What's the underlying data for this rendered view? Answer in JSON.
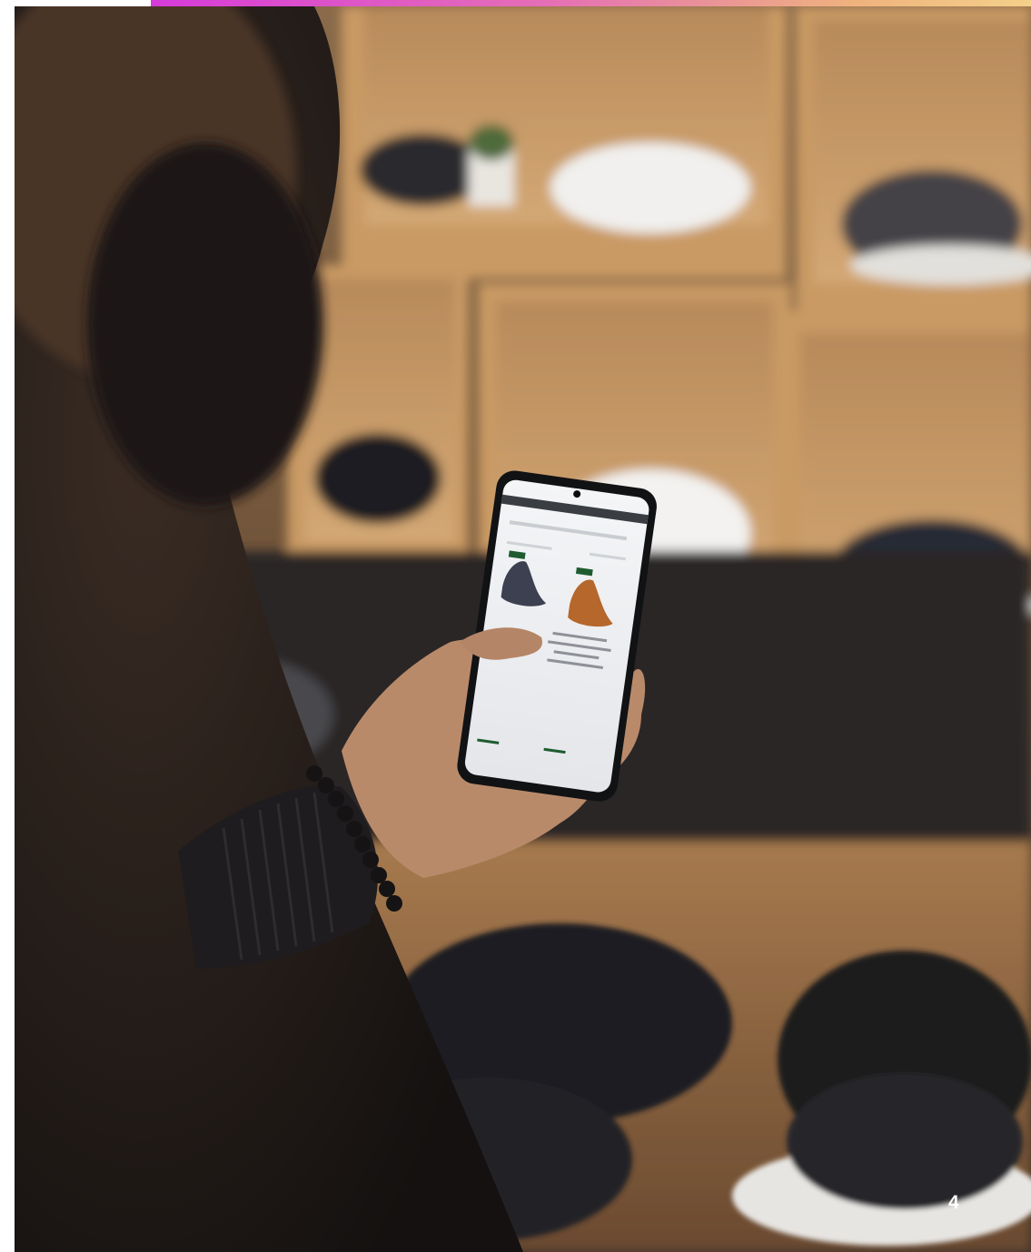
{
  "slide": {
    "page_number": "4"
  },
  "photo": {
    "subject": "person-using-smartphone-in-shoe-store-icon",
    "accent_gradient": [
      "#d63bd9",
      "#e56fb6",
      "#efb37e",
      "#f4d08a"
    ],
    "background_color": "#ffffff"
  }
}
